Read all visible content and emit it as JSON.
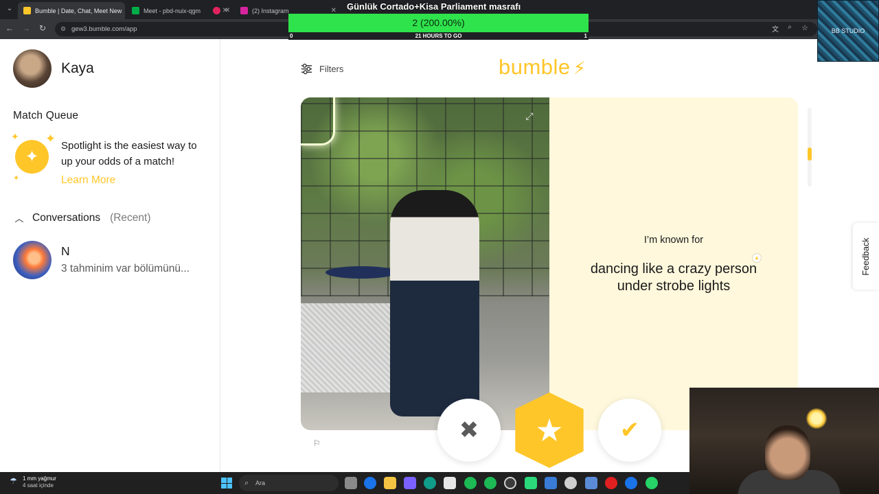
{
  "browser": {
    "tabs": [
      {
        "title": "Bumble | Date, Chat, Meet New",
        "active": true,
        "favicon_color": "#ffc629"
      },
      {
        "title": "Meet - pbd-nuix-qgm",
        "active": false,
        "favicon_color": "#00ac47"
      },
      {
        "title": "",
        "active": false,
        "favicon_color": "#e0245e"
      },
      {
        "title": "(2) Instagram",
        "active": false,
        "favicon_color": "#d6249f"
      }
    ],
    "new_tab": "+",
    "url": "gew3.bumble.com/app"
  },
  "overlay": {
    "title": "Günlük Cortado+Kisa Parliament masrafı",
    "progress_text": "2 (200.00%)",
    "progress": 1.0,
    "left_value": "0",
    "center_text": "21 HOURS TO GO",
    "right_value": "1",
    "bar_color": "#2fe34c",
    "corner_badge": "BB STUDIO"
  },
  "sidebar": {
    "user_name": "Kaya",
    "match_queue_title": "Match Queue",
    "spotlight_text": "Spotlight is the easiest way to up your odds of a match!",
    "learn_more": "Learn More",
    "conversations_label": "Conversations",
    "conversations_filter": "(Recent)",
    "conversations": [
      {
        "name": "N",
        "preview": "3 tahminim var bölümünü..."
      }
    ]
  },
  "main": {
    "filters_label": "Filters",
    "logo_text": "bumble",
    "logo_icon": "bolt-icon",
    "brand_color": "#ffc629",
    "profile_card": {
      "prompt_label": "I’m known for",
      "prompt_answer": "dancing like a crazy person under strobe lights"
    },
    "actions": {
      "pass_icon": "✖",
      "superswipe_icon": "★",
      "like_icon": "✔"
    },
    "feedback_label": "Feedback"
  },
  "taskbar": {
    "weather_line1": "1 mm yağmur",
    "weather_line2": "4 saat içinde",
    "search_placeholder": "Ara"
  }
}
